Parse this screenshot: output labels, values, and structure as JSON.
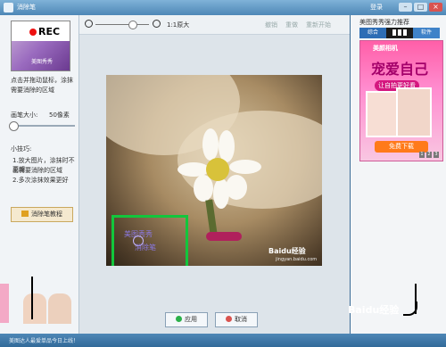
{
  "window": {
    "title": "消除笔",
    "login": "登录"
  },
  "left_panel": {
    "thumb_text": "REC",
    "thumb_caption": "美图秀秀",
    "hint": "点击并拖动鼠标，涂抹需要消除的区域",
    "pen_size_label": "画笔大小:",
    "pen_size_value": "50像素",
    "tips_title": "小技巧:",
    "tips": [
      "1.放大图片，涂抹时不要超",
      "出需要消除的区域",
      "2.多次涂抹效果更好"
    ],
    "erase_button": "消除笔教程"
  },
  "toolbar": {
    "one_to_one": "1:1原大",
    "undo": "撤销",
    "redo": "重做",
    "reset": "重新开始"
  },
  "canvas": {
    "selection_text1": "美图秀秀",
    "selection_text2": "消除笔",
    "watermark": "Baidu经验",
    "watermark_sub": "jingyan.baidu.com"
  },
  "bottom": {
    "apply": "应用",
    "cancel": "取消"
  },
  "right_panel": {
    "title": "美图秀秀强力推荐",
    "tabs": [
      "综合",
      "",
      "软件"
    ],
    "ad_brand": "美颜相机",
    "ad_headline": "宠爱自己",
    "ad_sub": "让自拍更好看",
    "ad_download": "免费下载",
    "ad_pages": [
      "1",
      "2",
      "3"
    ]
  },
  "overlay_logo": "Baidu经验",
  "status": {
    "text": "美图达人最爱单品今日上线！"
  }
}
